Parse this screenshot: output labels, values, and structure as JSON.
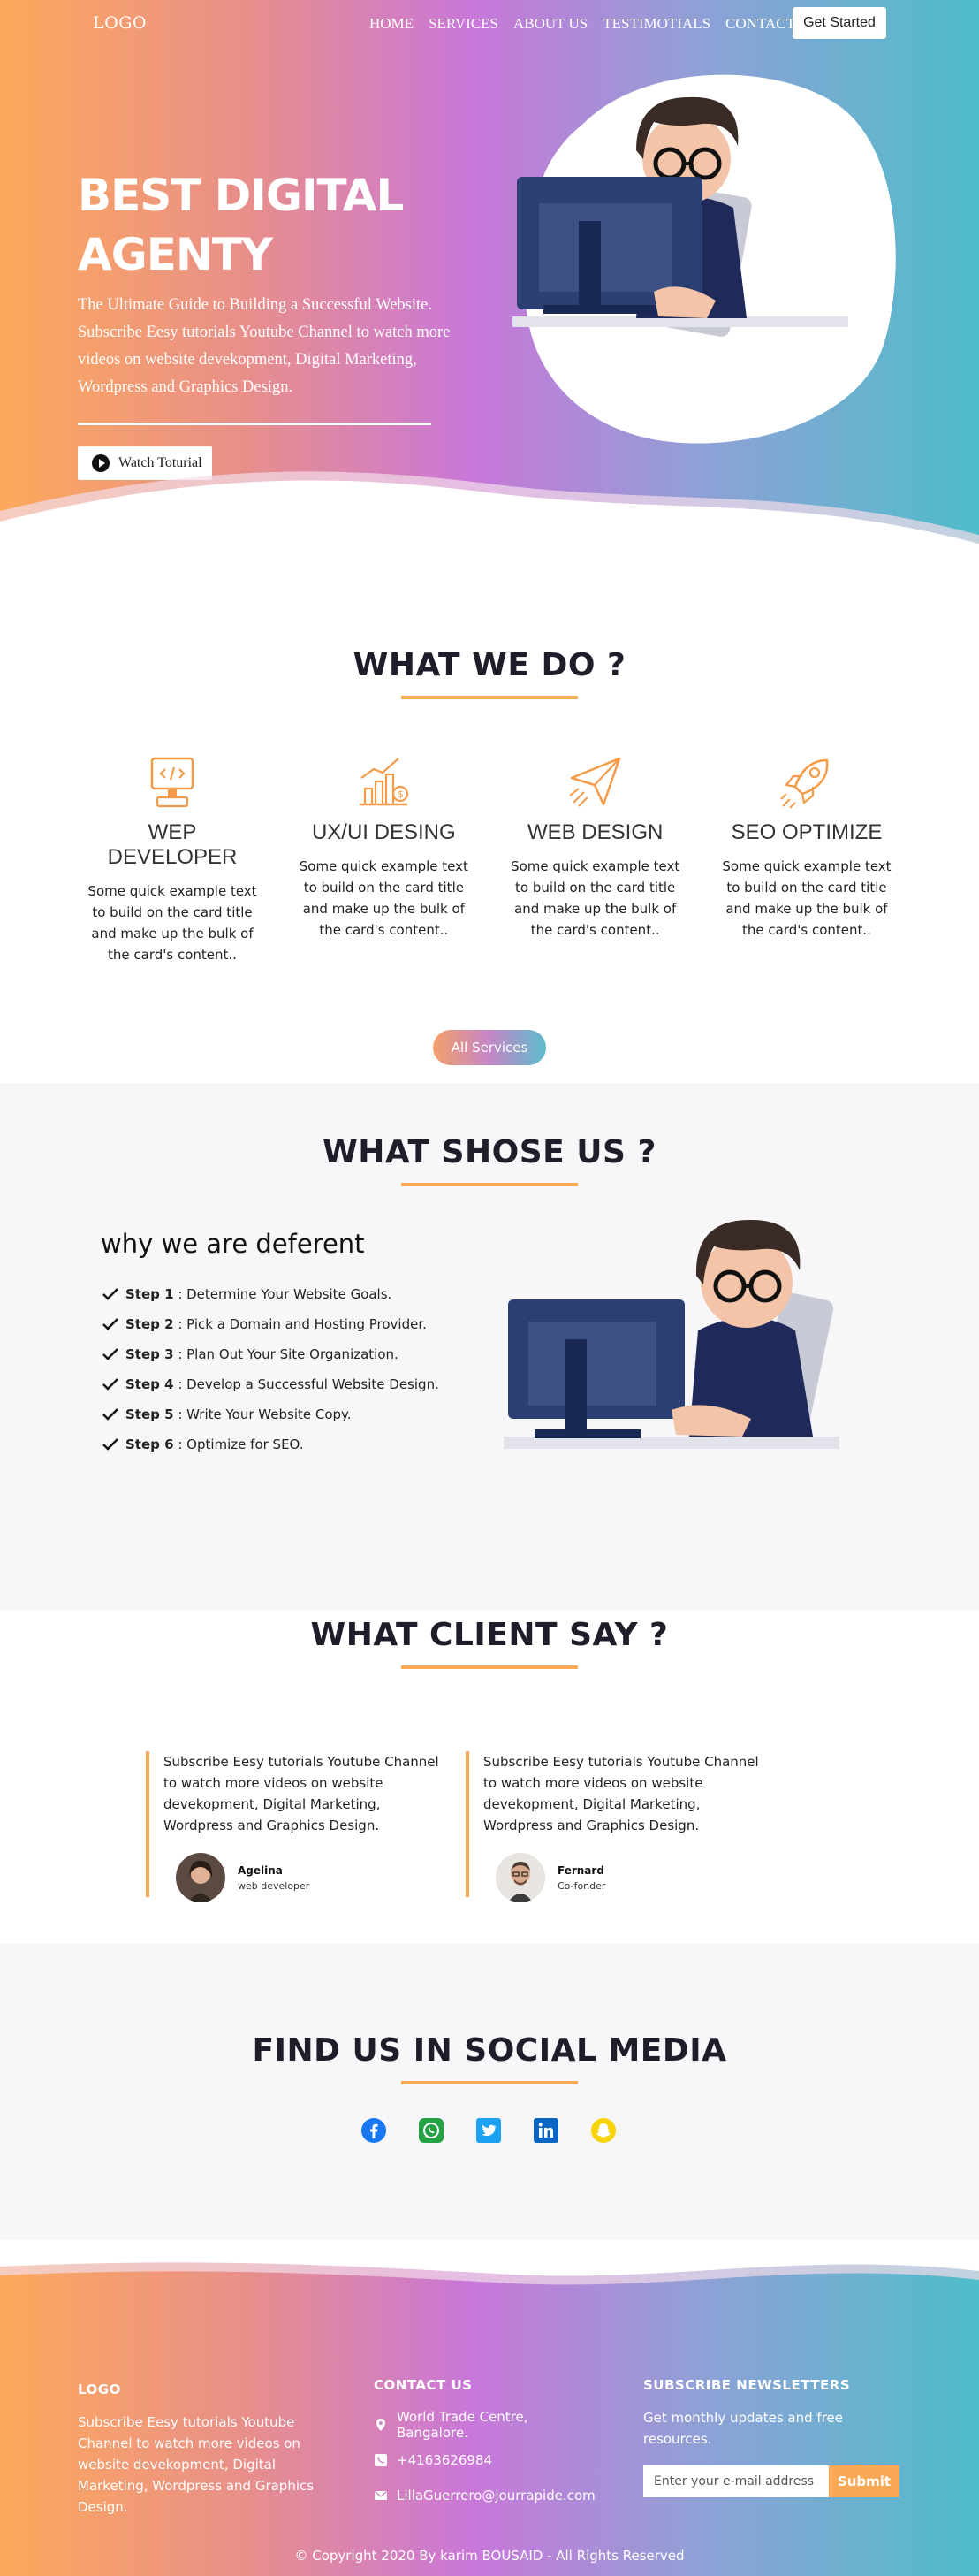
{
  "nav": {
    "logo": "LOGO",
    "links": [
      "HOME",
      "SERVICES",
      "ABOUT US",
      "TESTIMOTIALS",
      "CONTACT"
    ],
    "cta": "Get Started"
  },
  "hero": {
    "title": "BEST DIGITAL AGENTY",
    "subtitle_1": "The Ultimate Guide to Building a Successful Website.",
    "subtitle_2": "Subscribe Eesy tutorials Youtube Channel to watch more videos on website devekopment, Digital Marketing, Wordpress and Graphics Design.",
    "watch_button": "Watch Toturial"
  },
  "what_we_do": {
    "title": "WHAT WE DO ?",
    "cards": [
      {
        "title": "WEP DEVELOPER",
        "text": "Some quick example text to build on the card title and make up the bulk of the card's content..",
        "icon": "computer-code-icon"
      },
      {
        "title": "UX/UI DESING",
        "text": "Some quick example text to build on the card title and make up the bulk of the card's content..",
        "icon": "growth-chart-icon"
      },
      {
        "title": "WEB DESIGN",
        "text": "Some quick example text to build on the card title and make up the bulk of the card's content..",
        "icon": "paper-plane-icon"
      },
      {
        "title": "SEO OPTIMIZE",
        "text": "Some quick example text to build on the card title and make up the bulk of the card's content..",
        "icon": "rocket-icon"
      }
    ],
    "button": "All Services"
  },
  "why_us": {
    "title": "WHAT SHOSE US ?",
    "subtitle": "why we are deferent",
    "steps": [
      {
        "label": "Step 1",
        "text": " : Determine Your Website Goals."
      },
      {
        "label": "Step 2",
        "text": " : Pick a Domain and Hosting Provider."
      },
      {
        "label": "Step 3",
        "text": " : Plan Out Your Site Organization."
      },
      {
        "label": "Step 4",
        "text": " : Develop a Successful Website Design."
      },
      {
        "label": "Step 5",
        "text": " : Write Your Website Copy."
      },
      {
        "label": "Step 6",
        "text": " : Optimize for SEO."
      }
    ]
  },
  "clients": {
    "title": "WHAT CLIENT SAY ?",
    "testimonials": [
      {
        "quote": "Subscribe Eesy tutorials Youtube Channel to watch more videos on website devekopment, Digital Marketing, Wordpress and Graphics Design.",
        "name": "Agelina",
        "role": "web developer"
      },
      {
        "quote": "Subscribe Eesy tutorials Youtube Channel to watch more videos on website devekopment, Digital Marketing, Wordpress and Graphics Design.",
        "name": "Fernard",
        "role": "Co-fonder"
      }
    ]
  },
  "social": {
    "title": "FIND US IN SOCIAL MEDIA",
    "icons": [
      "facebook-icon",
      "whatsapp-icon",
      "twitter-icon",
      "linkedin-icon",
      "snapchat-icon"
    ],
    "colors": {
      "facebook": "#1877f2",
      "whatsapp": "#25a244",
      "twitter": "#1da1f2",
      "linkedin": "#0a66c2",
      "snapchat": "#f7d40a"
    }
  },
  "footer": {
    "logo": "LOGO",
    "about": "Subscribe Eesy tutorials Youtube Channel to watch more videos on website devekopment, Digital Marketing, Wordpress and Graphics Design.",
    "contact_title": "CONTACT US",
    "address": "World Trade Centre, Bangalore.",
    "phone": "+4163626984",
    "email": "LillaGuerrero@jourrapide.com",
    "newsletter_title": "SUBSCRIBE NEWSLETTERS",
    "newsletter_text": "Get monthly updates and free resources.",
    "email_placeholder": "Enter your e-mail address",
    "submit": "Submit",
    "copyright": "© Copyright 2020 By karim BOUSAID - All Rights Reserved"
  },
  "colors": {
    "accent": "#f9a856",
    "gradient_start": "#fda95b",
    "gradient_mid": "#c977d9",
    "gradient_end": "#4fbdca"
  }
}
